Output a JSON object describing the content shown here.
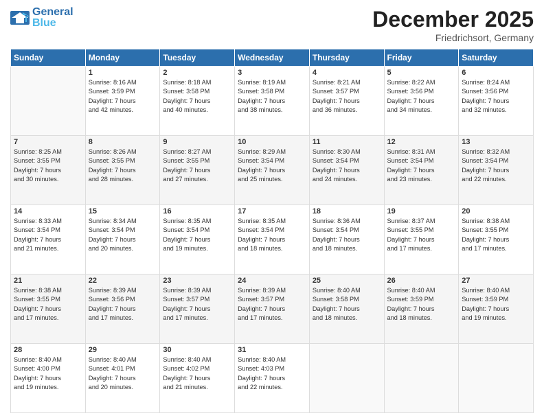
{
  "header": {
    "logo_line1": "General",
    "logo_line2": "Blue",
    "month": "December 2025",
    "location": "Friedrichsort, Germany"
  },
  "weekdays": [
    "Sunday",
    "Monday",
    "Tuesday",
    "Wednesday",
    "Thursday",
    "Friday",
    "Saturday"
  ],
  "weeks": [
    [
      {
        "day": "",
        "info": ""
      },
      {
        "day": "1",
        "info": "Sunrise: 8:16 AM\nSunset: 3:59 PM\nDaylight: 7 hours\nand 42 minutes."
      },
      {
        "day": "2",
        "info": "Sunrise: 8:18 AM\nSunset: 3:58 PM\nDaylight: 7 hours\nand 40 minutes."
      },
      {
        "day": "3",
        "info": "Sunrise: 8:19 AM\nSunset: 3:58 PM\nDaylight: 7 hours\nand 38 minutes."
      },
      {
        "day": "4",
        "info": "Sunrise: 8:21 AM\nSunset: 3:57 PM\nDaylight: 7 hours\nand 36 minutes."
      },
      {
        "day": "5",
        "info": "Sunrise: 8:22 AM\nSunset: 3:56 PM\nDaylight: 7 hours\nand 34 minutes."
      },
      {
        "day": "6",
        "info": "Sunrise: 8:24 AM\nSunset: 3:56 PM\nDaylight: 7 hours\nand 32 minutes."
      }
    ],
    [
      {
        "day": "7",
        "info": "Sunrise: 8:25 AM\nSunset: 3:55 PM\nDaylight: 7 hours\nand 30 minutes."
      },
      {
        "day": "8",
        "info": "Sunrise: 8:26 AM\nSunset: 3:55 PM\nDaylight: 7 hours\nand 28 minutes."
      },
      {
        "day": "9",
        "info": "Sunrise: 8:27 AM\nSunset: 3:55 PM\nDaylight: 7 hours\nand 27 minutes."
      },
      {
        "day": "10",
        "info": "Sunrise: 8:29 AM\nSunset: 3:54 PM\nDaylight: 7 hours\nand 25 minutes."
      },
      {
        "day": "11",
        "info": "Sunrise: 8:30 AM\nSunset: 3:54 PM\nDaylight: 7 hours\nand 24 minutes."
      },
      {
        "day": "12",
        "info": "Sunrise: 8:31 AM\nSunset: 3:54 PM\nDaylight: 7 hours\nand 23 minutes."
      },
      {
        "day": "13",
        "info": "Sunrise: 8:32 AM\nSunset: 3:54 PM\nDaylight: 7 hours\nand 22 minutes."
      }
    ],
    [
      {
        "day": "14",
        "info": "Sunrise: 8:33 AM\nSunset: 3:54 PM\nDaylight: 7 hours\nand 21 minutes."
      },
      {
        "day": "15",
        "info": "Sunrise: 8:34 AM\nSunset: 3:54 PM\nDaylight: 7 hours\nand 20 minutes."
      },
      {
        "day": "16",
        "info": "Sunrise: 8:35 AM\nSunset: 3:54 PM\nDaylight: 7 hours\nand 19 minutes."
      },
      {
        "day": "17",
        "info": "Sunrise: 8:35 AM\nSunset: 3:54 PM\nDaylight: 7 hours\nand 18 minutes."
      },
      {
        "day": "18",
        "info": "Sunrise: 8:36 AM\nSunset: 3:54 PM\nDaylight: 7 hours\nand 18 minutes."
      },
      {
        "day": "19",
        "info": "Sunrise: 8:37 AM\nSunset: 3:55 PM\nDaylight: 7 hours\nand 17 minutes."
      },
      {
        "day": "20",
        "info": "Sunrise: 8:38 AM\nSunset: 3:55 PM\nDaylight: 7 hours\nand 17 minutes."
      }
    ],
    [
      {
        "day": "21",
        "info": "Sunrise: 8:38 AM\nSunset: 3:55 PM\nDaylight: 7 hours\nand 17 minutes."
      },
      {
        "day": "22",
        "info": "Sunrise: 8:39 AM\nSunset: 3:56 PM\nDaylight: 7 hours\nand 17 minutes."
      },
      {
        "day": "23",
        "info": "Sunrise: 8:39 AM\nSunset: 3:57 PM\nDaylight: 7 hours\nand 17 minutes."
      },
      {
        "day": "24",
        "info": "Sunrise: 8:39 AM\nSunset: 3:57 PM\nDaylight: 7 hours\nand 17 minutes."
      },
      {
        "day": "25",
        "info": "Sunrise: 8:40 AM\nSunset: 3:58 PM\nDaylight: 7 hours\nand 18 minutes."
      },
      {
        "day": "26",
        "info": "Sunrise: 8:40 AM\nSunset: 3:59 PM\nDaylight: 7 hours\nand 18 minutes."
      },
      {
        "day": "27",
        "info": "Sunrise: 8:40 AM\nSunset: 3:59 PM\nDaylight: 7 hours\nand 19 minutes."
      }
    ],
    [
      {
        "day": "28",
        "info": "Sunrise: 8:40 AM\nSunset: 4:00 PM\nDaylight: 7 hours\nand 19 minutes."
      },
      {
        "day": "29",
        "info": "Sunrise: 8:40 AM\nSunset: 4:01 PM\nDaylight: 7 hours\nand 20 minutes."
      },
      {
        "day": "30",
        "info": "Sunrise: 8:40 AM\nSunset: 4:02 PM\nDaylight: 7 hours\nand 21 minutes."
      },
      {
        "day": "31",
        "info": "Sunrise: 8:40 AM\nSunset: 4:03 PM\nDaylight: 7 hours\nand 22 minutes."
      },
      {
        "day": "",
        "info": ""
      },
      {
        "day": "",
        "info": ""
      },
      {
        "day": "",
        "info": ""
      }
    ]
  ]
}
